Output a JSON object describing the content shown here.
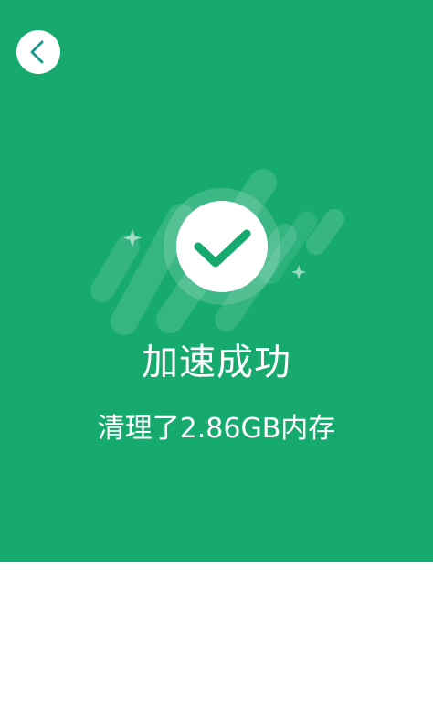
{
  "header": {
    "back_icon": "chevron-left-icon"
  },
  "result": {
    "status_icon": "checkmark-icon",
    "title": "加速成功",
    "message": "清理了2.86GB内存"
  },
  "colors": {
    "primary_green": "#17aa6f",
    "icon_accent": "#1e9a8a",
    "text": "#ffffff"
  }
}
